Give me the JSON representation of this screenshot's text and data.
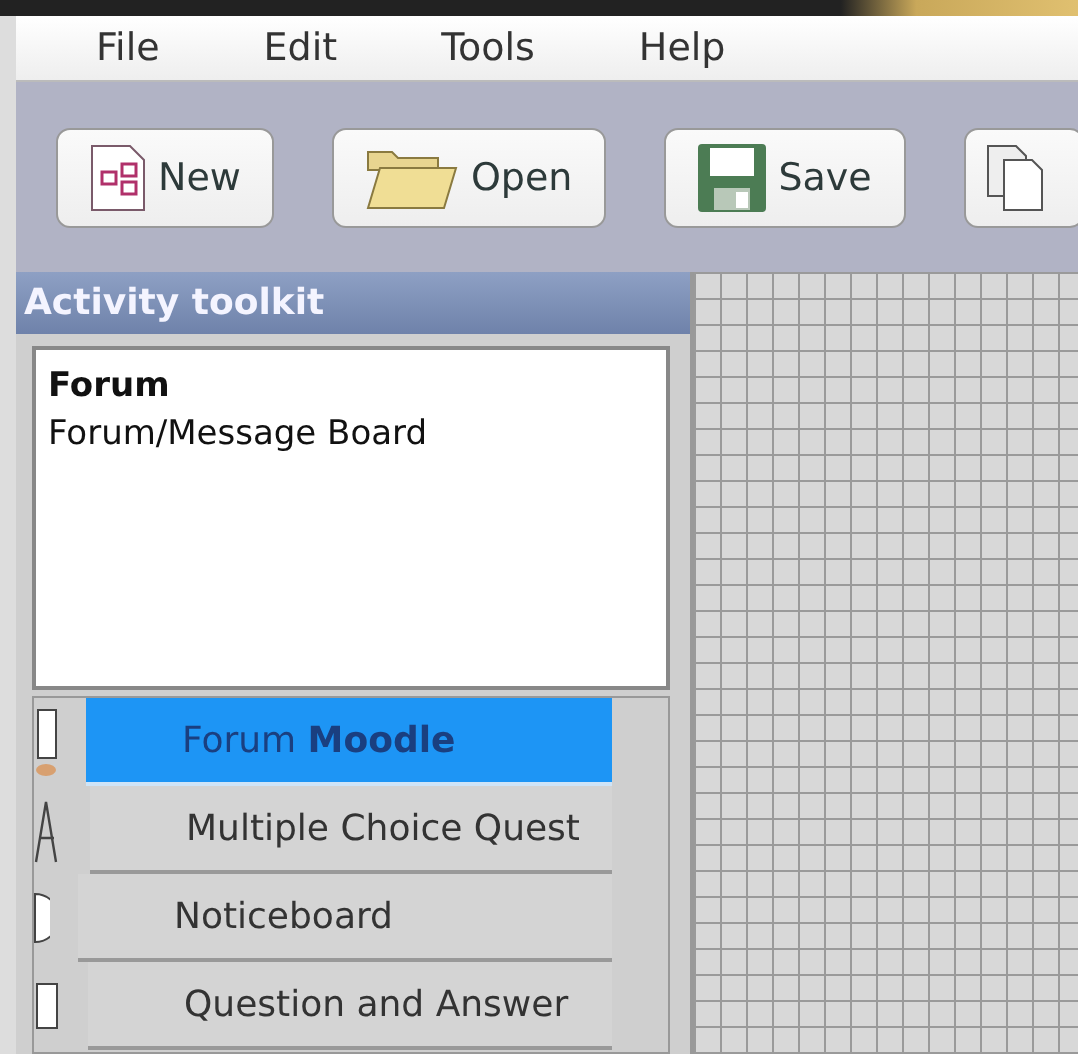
{
  "menu": [
    "File",
    "Edit",
    "Tools",
    "Help"
  ],
  "toolbar": [
    {
      "kind": "new",
      "label": "New"
    },
    {
      "kind": "open",
      "label": "Open"
    },
    {
      "kind": "save",
      "label": "Save"
    },
    {
      "kind": "copy"
    }
  ],
  "toolkit": {
    "title": "Activity toolkit",
    "description_title": "Forum",
    "description": "Forum/Message Board",
    "items": [
      {
        "label": "Forum **Moodle**",
        "selected": true,
        "kind": "forum"
      },
      {
        "label": "Multiple Choice Quest",
        "selected": false,
        "kind": "text"
      },
      {
        "label": "Noticeboard",
        "selected": false,
        "kind": "circle"
      },
      {
        "label": "Question and Answer",
        "selected": false,
        "kind": "square"
      }
    ]
  }
}
